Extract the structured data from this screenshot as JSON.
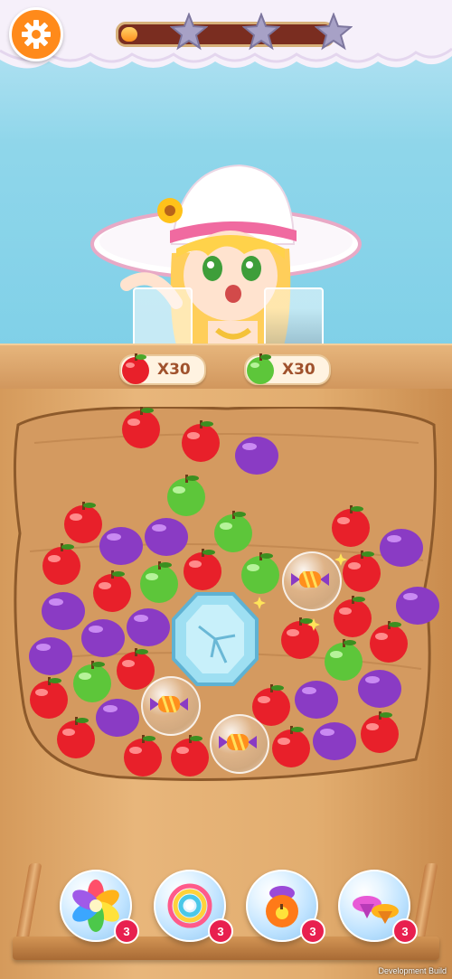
{
  "hud": {
    "settings_icon": "gear-icon",
    "progress_fraction": 0.08,
    "stars": [
      "star-icon",
      "star-icon",
      "star-icon"
    ],
    "stars_earned": 0
  },
  "goals": [
    {
      "fruit": "red-apple",
      "count_label": "X30"
    },
    {
      "fruit": "green-apple",
      "count_label": "X30"
    }
  ],
  "board": {
    "center_obstacle": "ice-block"
  },
  "boosters": [
    {
      "name": "rainbow-flower",
      "count": "3"
    },
    {
      "name": "rainbow-orb",
      "count": "3"
    },
    {
      "name": "magic-pot",
      "count": "3"
    },
    {
      "name": "spinning-top",
      "count": "3"
    }
  ],
  "footer": {
    "dev_label": "Development Build"
  },
  "colors": {
    "red_apple": "#e8202a",
    "green_apple": "#5dc63a",
    "plum": "#8a3bc4",
    "accent_orange": "#ff8a1a",
    "badge_red": "#e8204f"
  }
}
